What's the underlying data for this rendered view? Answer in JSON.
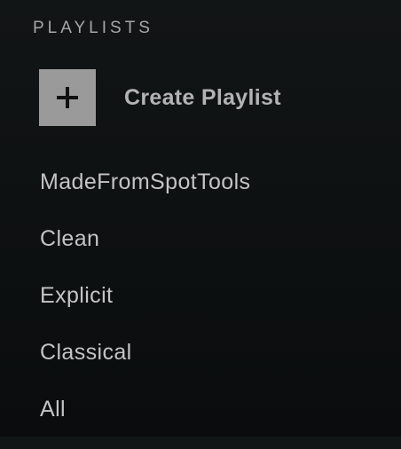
{
  "playlists_section": {
    "header": "PLAYLISTS",
    "create": {
      "label": "Create Playlist",
      "icon": "plus-icon"
    },
    "items": [
      {
        "label": "MadeFromSpotTools"
      },
      {
        "label": "Clean"
      },
      {
        "label": "Explicit"
      },
      {
        "label": "Classical"
      },
      {
        "label": "All"
      }
    ]
  },
  "colors": {
    "background": "#121516",
    "text": "#b3b3b3",
    "plus_box": "#9a9a9a",
    "plus_glyph": "#111111"
  }
}
